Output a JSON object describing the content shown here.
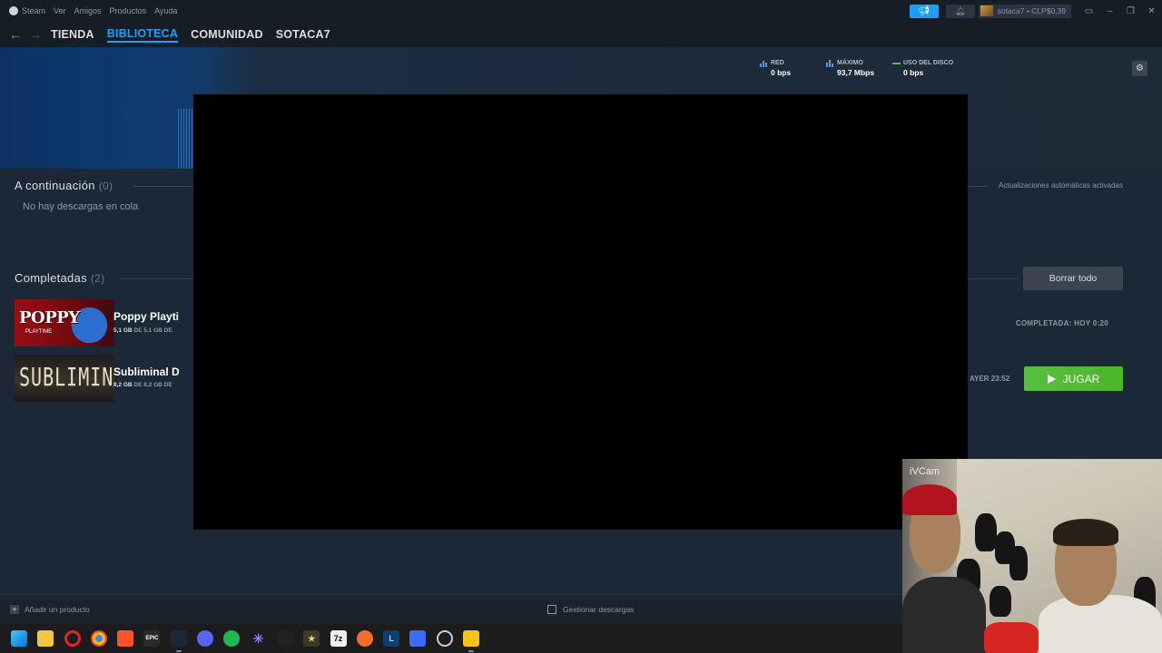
{
  "menubar": {
    "app_name": "Steam",
    "items": [
      "Ver",
      "Amigos",
      "Productos",
      "Ayuda"
    ],
    "account_label": "sotaca7 • CLP$0,39"
  },
  "nav": {
    "links": [
      "TIENDA",
      "BIBLIOTECA",
      "COMUNIDAD",
      "SOTACA7"
    ],
    "active": "BIBLIOTECA"
  },
  "stats": {
    "network_label": "RED",
    "network_value": "0 bps",
    "peak_label": "MÁXIMO",
    "peak_value": "93,7 Mbps",
    "disk_label": "USO DEL DISCO",
    "disk_value": "0 bps"
  },
  "queue": {
    "title": "A continuación",
    "count": "(0)",
    "empty_message": "No hay descargas en cola",
    "auto_updates": "Actualizaciones automáticas activadas"
  },
  "completed": {
    "title": "Completadas",
    "count": "(2)",
    "clear_all": "Borrar todo",
    "games": [
      {
        "name": "Poppy Playti",
        "size_done": "5,1 GB",
        "size_rest": "DE 5,1 GB DE",
        "status": "COMPLETADA: HOY 0:20",
        "thumb_title": "POPPY",
        "thumb_sub": "PLAYTIME"
      },
      {
        "name": "Subliminal D",
        "size_done": "8,2 GB",
        "size_rest": "DE 8,2 GB DE",
        "status": "AYER 23:52",
        "thumb_title": "SUBLIMINAL",
        "play_label": "JUGAR"
      }
    ]
  },
  "bottom": {
    "add_product": "Añadir un producto",
    "manage_downloads": "Gestionar descargas"
  },
  "webcam": {
    "label": "iVCam"
  },
  "colors": {
    "accent": "#1a9fff",
    "play_green": "#59bf40",
    "background": "#1b2838"
  },
  "taskbar": {
    "icons": [
      "windows-icon",
      "file-explorer-icon",
      "opera-icon",
      "chrome-icon",
      "brave-icon",
      "epic-games-icon",
      "steam-icon",
      "discord-icon",
      "spotify-icon",
      "star-app-icon",
      "blank-app-icon",
      "movie-app-icon",
      "7zip-icon",
      "origin-icon",
      "lunar-icon",
      "roblox-icon",
      "settings-icon",
      "ivcam-icon"
    ]
  }
}
